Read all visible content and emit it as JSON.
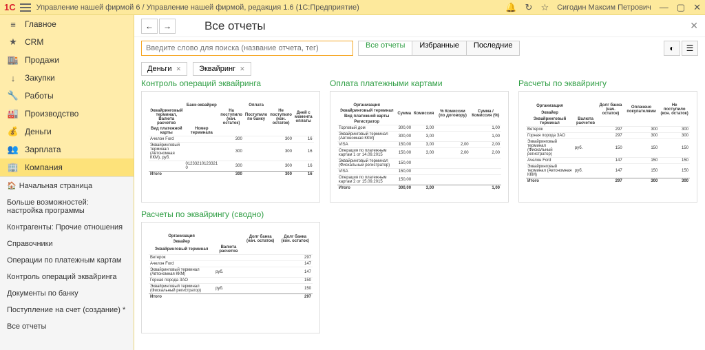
{
  "titlebar": {
    "logo": "1С",
    "title": "Управление нашей фирмой 6 / Управление нашей фирмой, редакция 1.6  (1С:Предприятие)",
    "username": "Сигодин Максим Петрович"
  },
  "sidebar": {
    "primary": [
      {
        "icon": "≡",
        "label": "Главное"
      },
      {
        "icon": "★",
        "label": "CRM"
      },
      {
        "icon": "🏬",
        "label": "Продажи"
      },
      {
        "icon": "↓",
        "label": "Закупки"
      },
      {
        "icon": "🔧",
        "label": "Работы"
      },
      {
        "icon": "🏭",
        "label": "Производство"
      },
      {
        "icon": "💰",
        "label": "Деньги"
      },
      {
        "icon": "👥",
        "label": "Зарплата"
      },
      {
        "icon": "🏢",
        "label": "Компания"
      }
    ],
    "secondary": [
      "Начальная страница",
      "Больше возможностей: настройка программы",
      "Контрагенты: Прочие отношения",
      "Справочники",
      "Операции по платежным картам",
      "Контроль операций эквайринга",
      "Документы по банку",
      "Поступление на счет (создание) *",
      "Все отчеты"
    ]
  },
  "main": {
    "page_title": "Все отчеты",
    "search_placeholder": "Введите слово для поиска (название отчета, тег)",
    "segments": [
      "Все отчеты",
      "Избранные",
      "Последние"
    ],
    "tags": [
      "Деньги",
      "Эквайринг"
    ]
  },
  "reports": {
    "r1": {
      "title": "Контроль операций эквайринга"
    },
    "r2": {
      "title": "Оплата платежными картами"
    },
    "r3": {
      "title": "Расчеты по эквайрингу"
    },
    "r4": {
      "title": "Расчеты по эквайрингу (сводно)"
    }
  },
  "preview1": {
    "h1": "Банк-эквайрер",
    "h2": "Оплата",
    "c1": "Эквайринговый терминал, Валюта расчетов",
    "c2": "На поступило (нач. остаток)",
    "c3": "Поступило по банку",
    "c4": "Не поступило (кон. остаток)",
    "c5": "Дней с момента оплаты",
    "sub1": "Вид платежной карты",
    "sub2": "Номер терминала",
    "row1": {
      "a": "Ачелон Ford",
      "b": "300",
      "c": "300",
      "d": "16"
    },
    "row2": {
      "a": "Эквайринговый терминал (Автономная ККМ), руб.",
      "b": "300",
      "c": "300",
      "d": "16"
    },
    "row3": {
      "a": "",
      "num": "01233210123321 0",
      "b": "300",
      "c": "300",
      "d": "16"
    },
    "total": {
      "a": "Итого",
      "b": "300",
      "c": "300",
      "d": "16"
    }
  },
  "preview2": {
    "h1": "Организация",
    "h2": "Эквайринговый терминал",
    "h3": "Вид платежной карты",
    "h4": "Регистратор",
    "c1": "Сумма",
    "c2": "Комиссия",
    "c3": "% Комиссии (по договору)",
    "c4": "Сумма / Комиссия (%)",
    "r1": {
      "a": "Торговый дом",
      "b": "300,00",
      "c": "3,00",
      "d": "",
      "e": "1,00"
    },
    "r2": {
      "a": "Эквайринговый терминал  (Автономная ККМ)",
      "b": "300,00",
      "c": "3,00",
      "d": "",
      "e": "1,00"
    },
    "r3": {
      "a": "VISA",
      "b": "150,00",
      "c": "3,00",
      "d": "2,00",
      "e": "2,00"
    },
    "r4": {
      "a": "Операция по платежным картам 1 от 14.09.2015",
      "b": "150,00",
      "c": "3,00",
      "d": "2,00",
      "e": "2,00"
    },
    "r5": {
      "a": "Эквайринговый терминал  (Фискальный регистратор)",
      "b": "150,00"
    },
    "r6": {
      "a": "VISA",
      "b": "150,00"
    },
    "r7": {
      "a": "Операция по платежным картам 2 от 15.09.2015",
      "b": "150,00"
    },
    "total": {
      "a": "Итого",
      "b": "300,00",
      "c": "3,00",
      "e": "1,00"
    }
  },
  "preview3": {
    "h1": "Организация",
    "h2": "Эквайер",
    "c1": "Эквайринговый терминал",
    "c2": "Валюта расчетов",
    "c3": "Долг банка (нач. остаток)",
    "c4": "Оплачено покупателями",
    "c5": "Не поступило (кон. остаток)",
    "r1": {
      "a": "Ветерок",
      "b": "297",
      "c": "300",
      "d": "300"
    },
    "r2": {
      "a": "Горная порода ЗАО",
      "b": "297",
      "c": "300",
      "d": "300"
    },
    "r3": {
      "a": "Эквайринговый терминал  (Фискальный регистратор)",
      "v": "руб.",
      "b": "150",
      "c": "150",
      "d": "150"
    },
    "r4": {
      "a": "Ачелон Ford",
      "b": "147",
      "c": "150",
      "d": "150"
    },
    "r5": {
      "a": "Эквайринговый терминал  (Автономная ККМ)",
      "v": "руб.",
      "b": "147",
      "c": "150",
      "d": "150"
    },
    "total": {
      "a": "Итого",
      "b": "297",
      "c": "300",
      "d": "300"
    }
  },
  "preview4": {
    "h1": "Организация",
    "h2": "Эквайер",
    "c1": "Эквайринговый терминал",
    "c2": "Валюта расчетов",
    "c3": "Долг банка (нач. остаток)",
    "c4": "Долг банка (кон. остаток)",
    "r1": {
      "a": "Ветерок",
      "b": "297"
    },
    "r2": {
      "a": "Ачелон Ford",
      "b": "147"
    },
    "r3": {
      "a": "Эквайринговый терминал  (Автономная ККМ)",
      "v": "руб.",
      "b": "147"
    },
    "r4": {
      "a": "Горная порода ЗАО",
      "b": "150"
    },
    "r5": {
      "a": "Эквайринговый терминал  (Фискальный регистратор)",
      "v": "руб.",
      "b": "150"
    },
    "total": {
      "a": "Итого",
      "b": "297"
    }
  }
}
